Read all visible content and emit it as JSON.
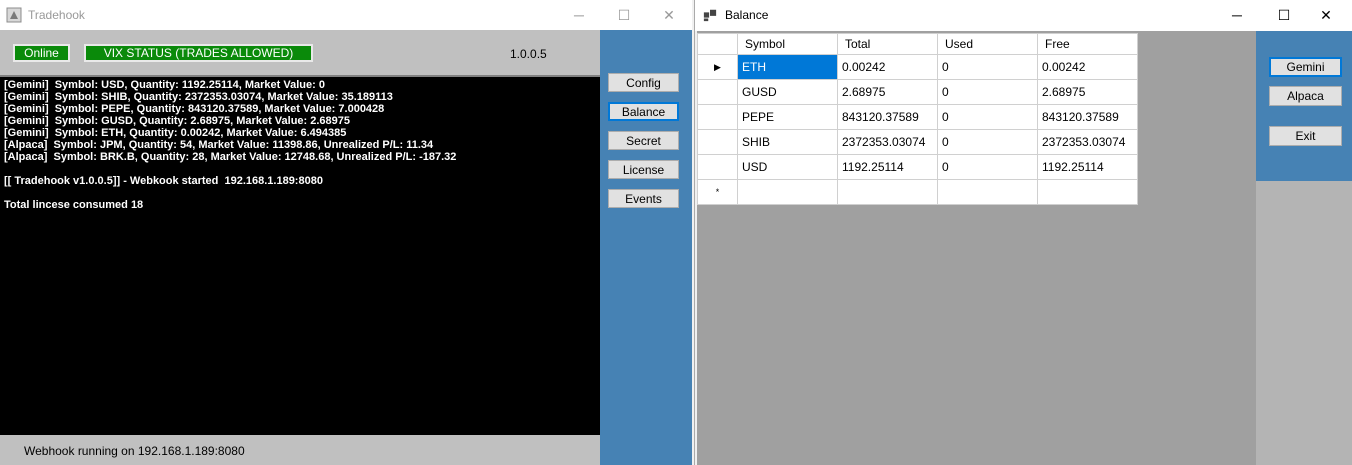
{
  "tradehook": {
    "title": "Tradehook",
    "status_online": "Online",
    "status_vix": "VIX STATUS (TRADES ALLOWED)",
    "version": "1.0.0.5",
    "console_lines": [
      "[Gemini]  Symbol: USD, Quantity: 1192.25114, Market Value: 0",
      "[Gemini]  Symbol: SHIB, Quantity: 2372353.03074, Market Value: 35.189113",
      "[Gemini]  Symbol: PEPE, Quantity: 843120.37589, Market Value: 7.000428",
      "[Gemini]  Symbol: GUSD, Quantity: 2.68975, Market Value: 2.68975",
      "[Gemini]  Symbol: ETH, Quantity: 0.00242, Market Value: 6.494385",
      "[Alpaca]  Symbol: JPM, Quantity: 54, Market Value: 11398.86, Unrealized P/L: 11.34",
      "[Alpaca]  Symbol: BRK.B, Quantity: 28, Market Value: 12748.68, Unrealized P/L: -187.32",
      "",
      "[[ Tradehook v1.0.0.5]] - Webkook started  192.168.1.189:8080",
      "",
      "Total lincese consumed 18"
    ],
    "statusbar": "Webhook running on 192.168.1.189:8080",
    "buttons": {
      "config": "Config",
      "balance": "Balance",
      "secret": "Secret",
      "license": "License",
      "events": "Events"
    }
  },
  "balance": {
    "title": "Balance",
    "columns": [
      "Symbol",
      "Total",
      "Used",
      "Free"
    ],
    "rows": [
      [
        "ETH",
        "0.00242",
        "0",
        "0.00242"
      ],
      [
        "GUSD",
        "2.68975",
        "0",
        "2.68975"
      ],
      [
        "PEPE",
        "843120.37589",
        "0",
        "843120.37589"
      ],
      [
        "SHIB",
        "2372353.03074",
        "0",
        "2372353.03074"
      ],
      [
        "USD",
        "1192.25114",
        "0",
        "1192.25114"
      ]
    ],
    "buttons": {
      "gemini": "Gemini",
      "alpaca": "Alpaca",
      "exit": "Exit"
    }
  },
  "caption": {
    "minimize": "─",
    "maximize": "☐",
    "close": "✕"
  },
  "row_markers": {
    "current": "▶",
    "new": "*"
  }
}
